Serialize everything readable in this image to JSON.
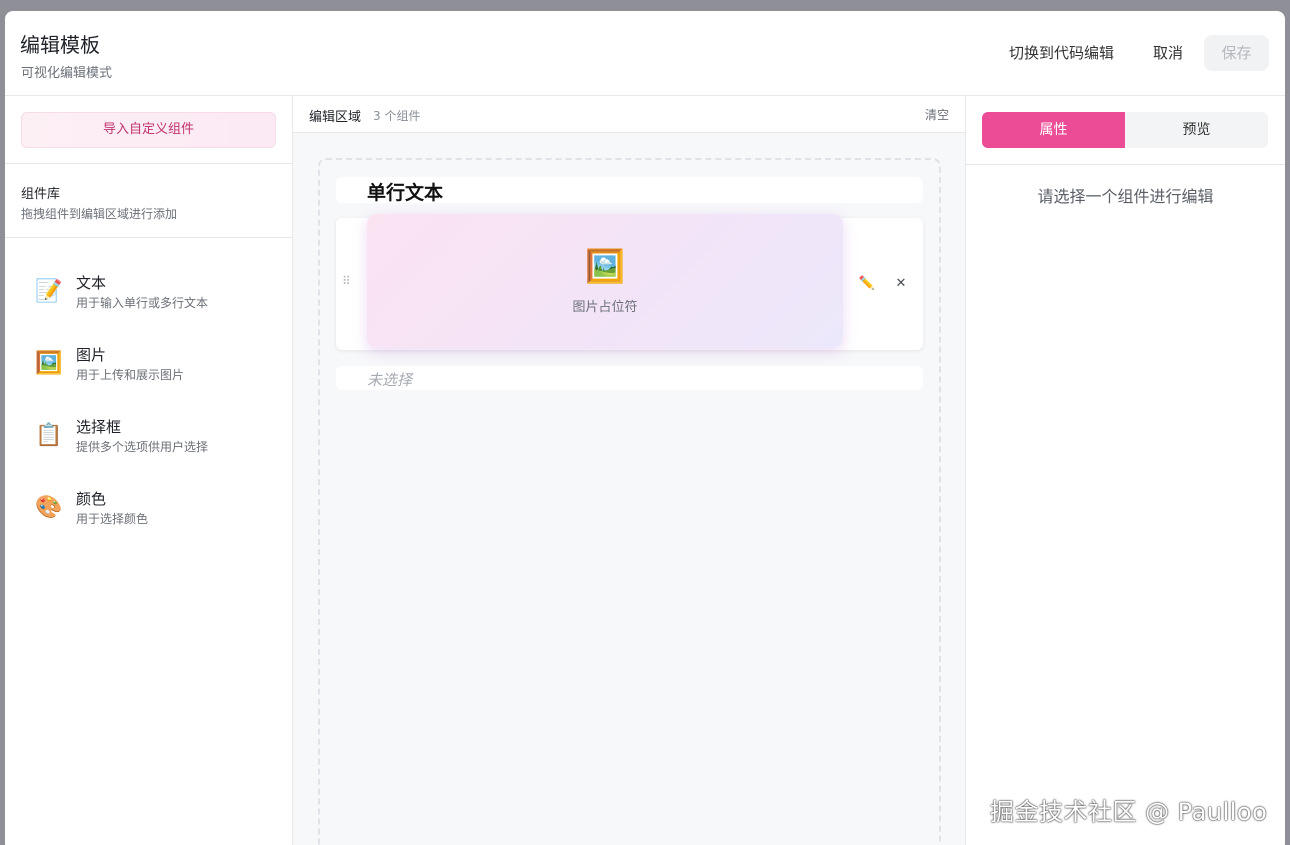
{
  "header": {
    "title": "编辑模板",
    "subtitle": "可视化编辑模式",
    "switch_label": "切换到代码编辑",
    "cancel_label": "取消",
    "save_label": "保存"
  },
  "left": {
    "import_label": "导入自定义组件",
    "library_title": "组件库",
    "library_desc": "拖拽组件到编辑区域进行添加",
    "items": [
      {
        "icon": "memo-icon",
        "glyph": "📝",
        "name": "文本",
        "desc": "用于输入单行或多行文本"
      },
      {
        "icon": "framed-picture-icon",
        "glyph": "🖼️",
        "name": "图片",
        "desc": "用于上传和展示图片"
      },
      {
        "icon": "clipboard-icon",
        "glyph": "📋",
        "name": "选择框",
        "desc": "提供多个选项供用户选择"
      },
      {
        "icon": "palette-icon",
        "glyph": "🎨",
        "name": "颜色",
        "desc": "用于选择颜色"
      }
    ]
  },
  "center": {
    "title": "编辑区域",
    "count": "3 个组件",
    "clear_label": "清空",
    "rows": {
      "text_label": "单行文本",
      "image_icon": "🖼️",
      "image_label": "图片占位符",
      "select_label": "未选择"
    },
    "edit_glyph": "✏️",
    "delete_glyph": "✕",
    "handle_glyph": "⠿"
  },
  "right": {
    "tab_props": "属性",
    "tab_preview": "预览",
    "empty_tip": "请选择一个组件进行编辑"
  },
  "watermark": "掘金技术社区 @ Paulloo",
  "colors": {
    "accent": "#ec4b96",
    "import_text": "#c2336f"
  }
}
